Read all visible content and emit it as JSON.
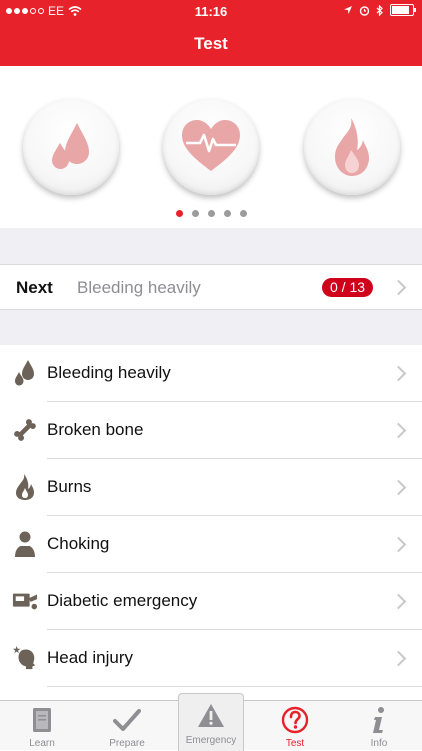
{
  "status": {
    "carrier": "EE",
    "time": "11:16"
  },
  "nav": {
    "title": "Test"
  },
  "carousel": {
    "items": [
      {
        "icon": "blood-drops-icon"
      },
      {
        "icon": "heart-pulse-icon"
      },
      {
        "icon": "flame-icon"
      }
    ],
    "page_count": 5,
    "active_page": 1
  },
  "next": {
    "label": "Next",
    "value": "Bleeding heavily",
    "progress": "0 / 13"
  },
  "list": {
    "items": [
      {
        "label": "Bleeding heavily",
        "icon": "blood-drop-icon"
      },
      {
        "label": "Broken bone",
        "icon": "bone-icon"
      },
      {
        "label": "Burns",
        "icon": "fire-icon"
      },
      {
        "label": "Choking",
        "icon": "choking-person-icon"
      },
      {
        "label": "Diabetic emergency",
        "icon": "diabetes-kit-icon"
      },
      {
        "label": "Head injury",
        "icon": "head-injury-icon"
      }
    ]
  },
  "tabs": [
    {
      "label": "Learn",
      "icon": "book-icon"
    },
    {
      "label": "Prepare",
      "icon": "checkmark-icon"
    },
    {
      "label": "Emergency",
      "icon": "warning-triangle-icon"
    },
    {
      "label": "Test",
      "icon": "question-circle-icon"
    },
    {
      "label": "Info",
      "icon": "info-icon"
    }
  ],
  "colors": {
    "brand_red": "#e8222b",
    "icon_pink": "#e8a6a6",
    "icon_brown": "#6d6258",
    "tab_gray": "#8e8e93"
  }
}
